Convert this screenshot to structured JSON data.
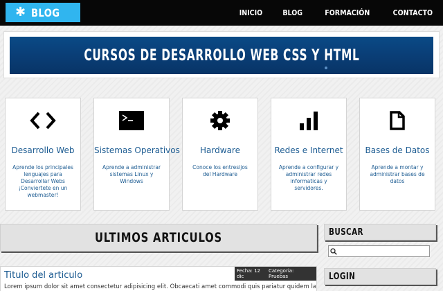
{
  "header": {
    "logo_icon": "gear-icon",
    "logo_text": "BLOG",
    "brand_color": "#30b5ef",
    "nav": [
      "INICIO",
      "BLOG",
      "FORMACIÓN",
      "CONTACTO"
    ]
  },
  "banner": {
    "title": "CURSOS DE DESARROLLO WEB CSS Y HTML"
  },
  "cards": [
    {
      "icon": "code-icon",
      "title": "Desarrollo Web",
      "desc": "Aprende los principales lenguajes para Desarrollar Webs ¡Conviertete en un webmaster!"
    },
    {
      "icon": "terminal-icon",
      "title": "Sistemas Operativos",
      "desc": "Aprende a administrar sistemas Linux y Windows"
    },
    {
      "icon": "gear-icon",
      "title": "Hardware",
      "desc": "Conoce los entresijos del Hardware"
    },
    {
      "icon": "signal-bars-icon",
      "title": "Redes e Internet",
      "desc": "Aprende a configurar y administrar redes informaticas y servidores."
    },
    {
      "icon": "document-icon",
      "title": "Bases de Datos",
      "desc": "Aprende a montar y administrar bases de datos"
    }
  ],
  "main": {
    "section_title": "ULTIMOS ARTICULOS",
    "article": {
      "title": "Titulo del articulo",
      "date": "Fecha: 12 dic",
      "category": "Categoria: Pruebas",
      "excerpt": "Lorem ipsum dolor sit amet consectetur adipisicing elit. Obcaecati amet commodi quis pariatur quidem laboriosam atque in"
    }
  },
  "sidebar": {
    "search_title": "BUSCAR",
    "search_placeholder": "",
    "login_title": "LOGIN"
  }
}
